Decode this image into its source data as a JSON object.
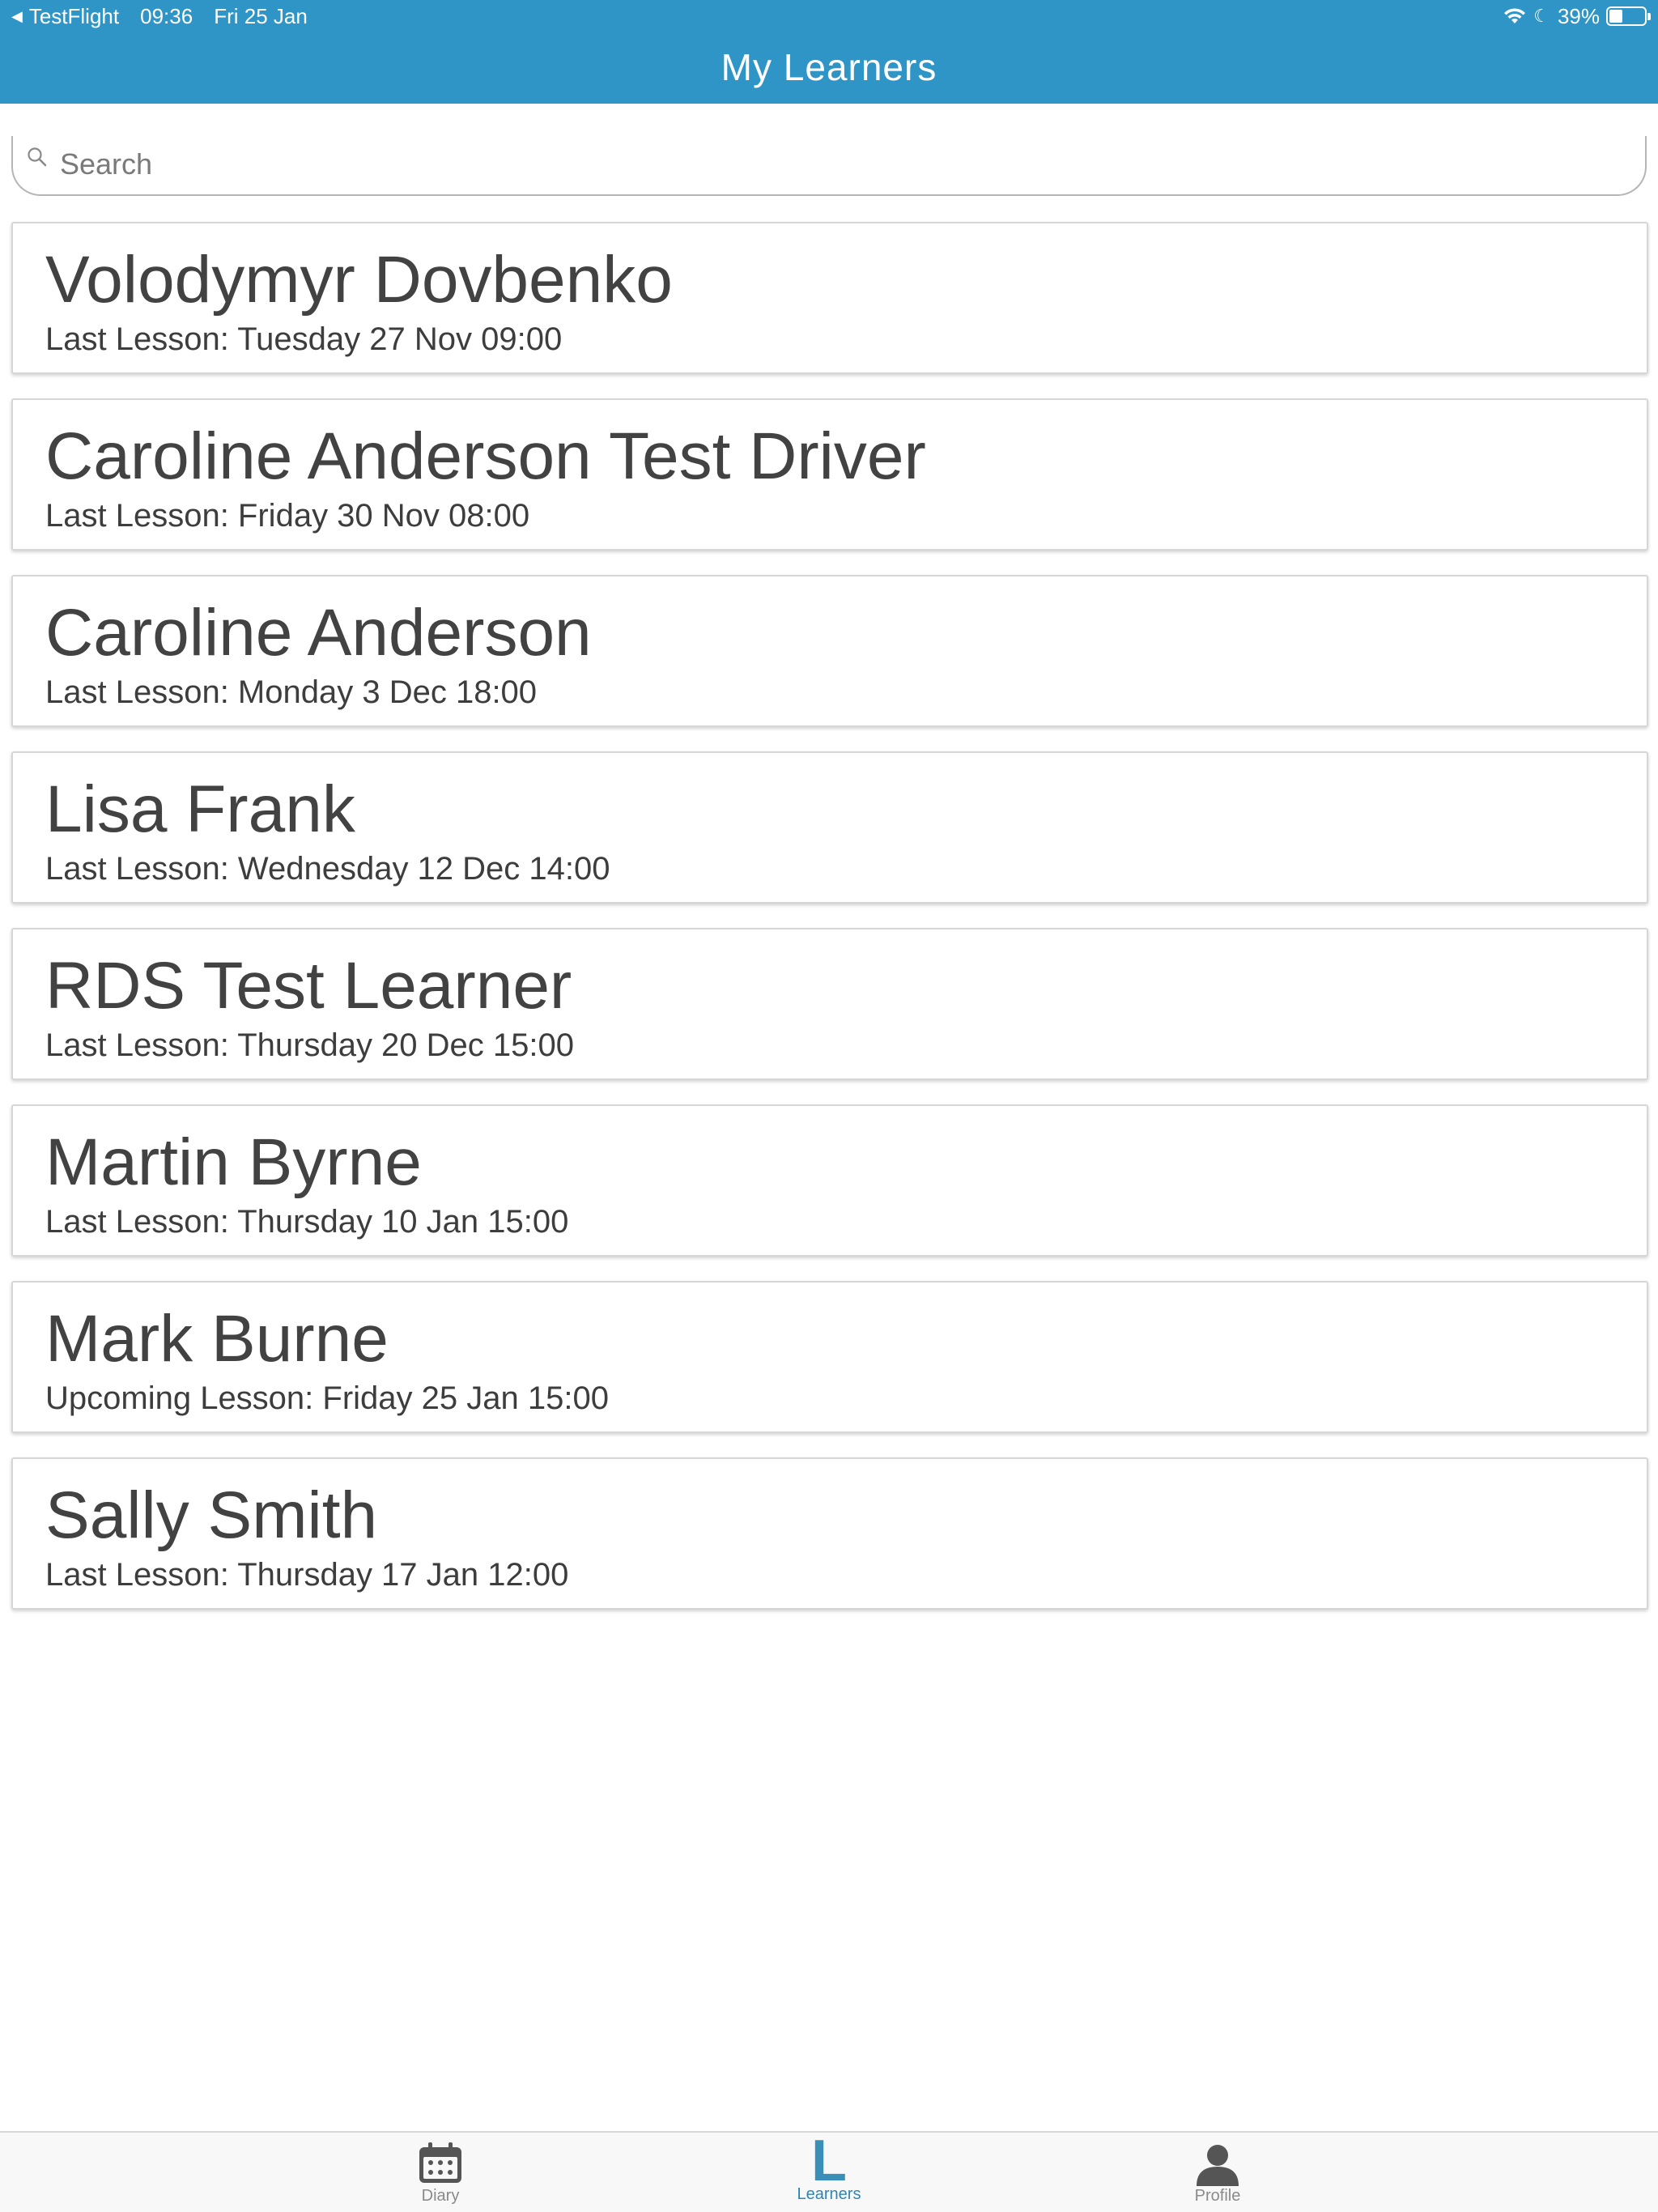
{
  "status_bar": {
    "back_app": "TestFlight",
    "time": "09:36",
    "date": "Fri 25 Jan",
    "battery_percent": "39%",
    "battery_level": 0.39
  },
  "header": {
    "title": "My Learners"
  },
  "search": {
    "placeholder": "Search",
    "value": ""
  },
  "learners": [
    {
      "name": "Volodymyr Dovbenko",
      "lesson": "Last Lesson: Tuesday 27 Nov 09:00"
    },
    {
      "name": "Caroline Anderson Test Driver",
      "lesson": "Last Lesson: Friday 30 Nov 08:00"
    },
    {
      "name": "Caroline Anderson",
      "lesson": "Last Lesson: Monday 3 Dec 18:00"
    },
    {
      "name": "Lisa Frank",
      "lesson": "Last Lesson: Wednesday 12 Dec 14:00"
    },
    {
      "name": "RDS Test Learner",
      "lesson": "Last Lesson: Thursday 20 Dec 15:00"
    },
    {
      "name": "Martin Byrne",
      "lesson": "Last Lesson: Thursday 10 Jan 15:00"
    },
    {
      "name": "Mark Burne",
      "lesson": "Upcoming Lesson: Friday 25 Jan 15:00"
    },
    {
      "name": "Sally Smith",
      "lesson": "Last Lesson: Thursday 17 Jan 12:00"
    }
  ],
  "tabs": [
    {
      "label": "Diary",
      "icon": "calendar-icon",
      "active": false
    },
    {
      "label": "Learners",
      "icon": "learners-icon",
      "active": true
    },
    {
      "label": "Profile",
      "icon": "person-icon",
      "active": false
    }
  ],
  "colors": {
    "header_bg": "#2e95c6",
    "active_tab": "#2e86b3",
    "inactive_tab": "#8a8a8a",
    "text_primary": "#424242"
  }
}
